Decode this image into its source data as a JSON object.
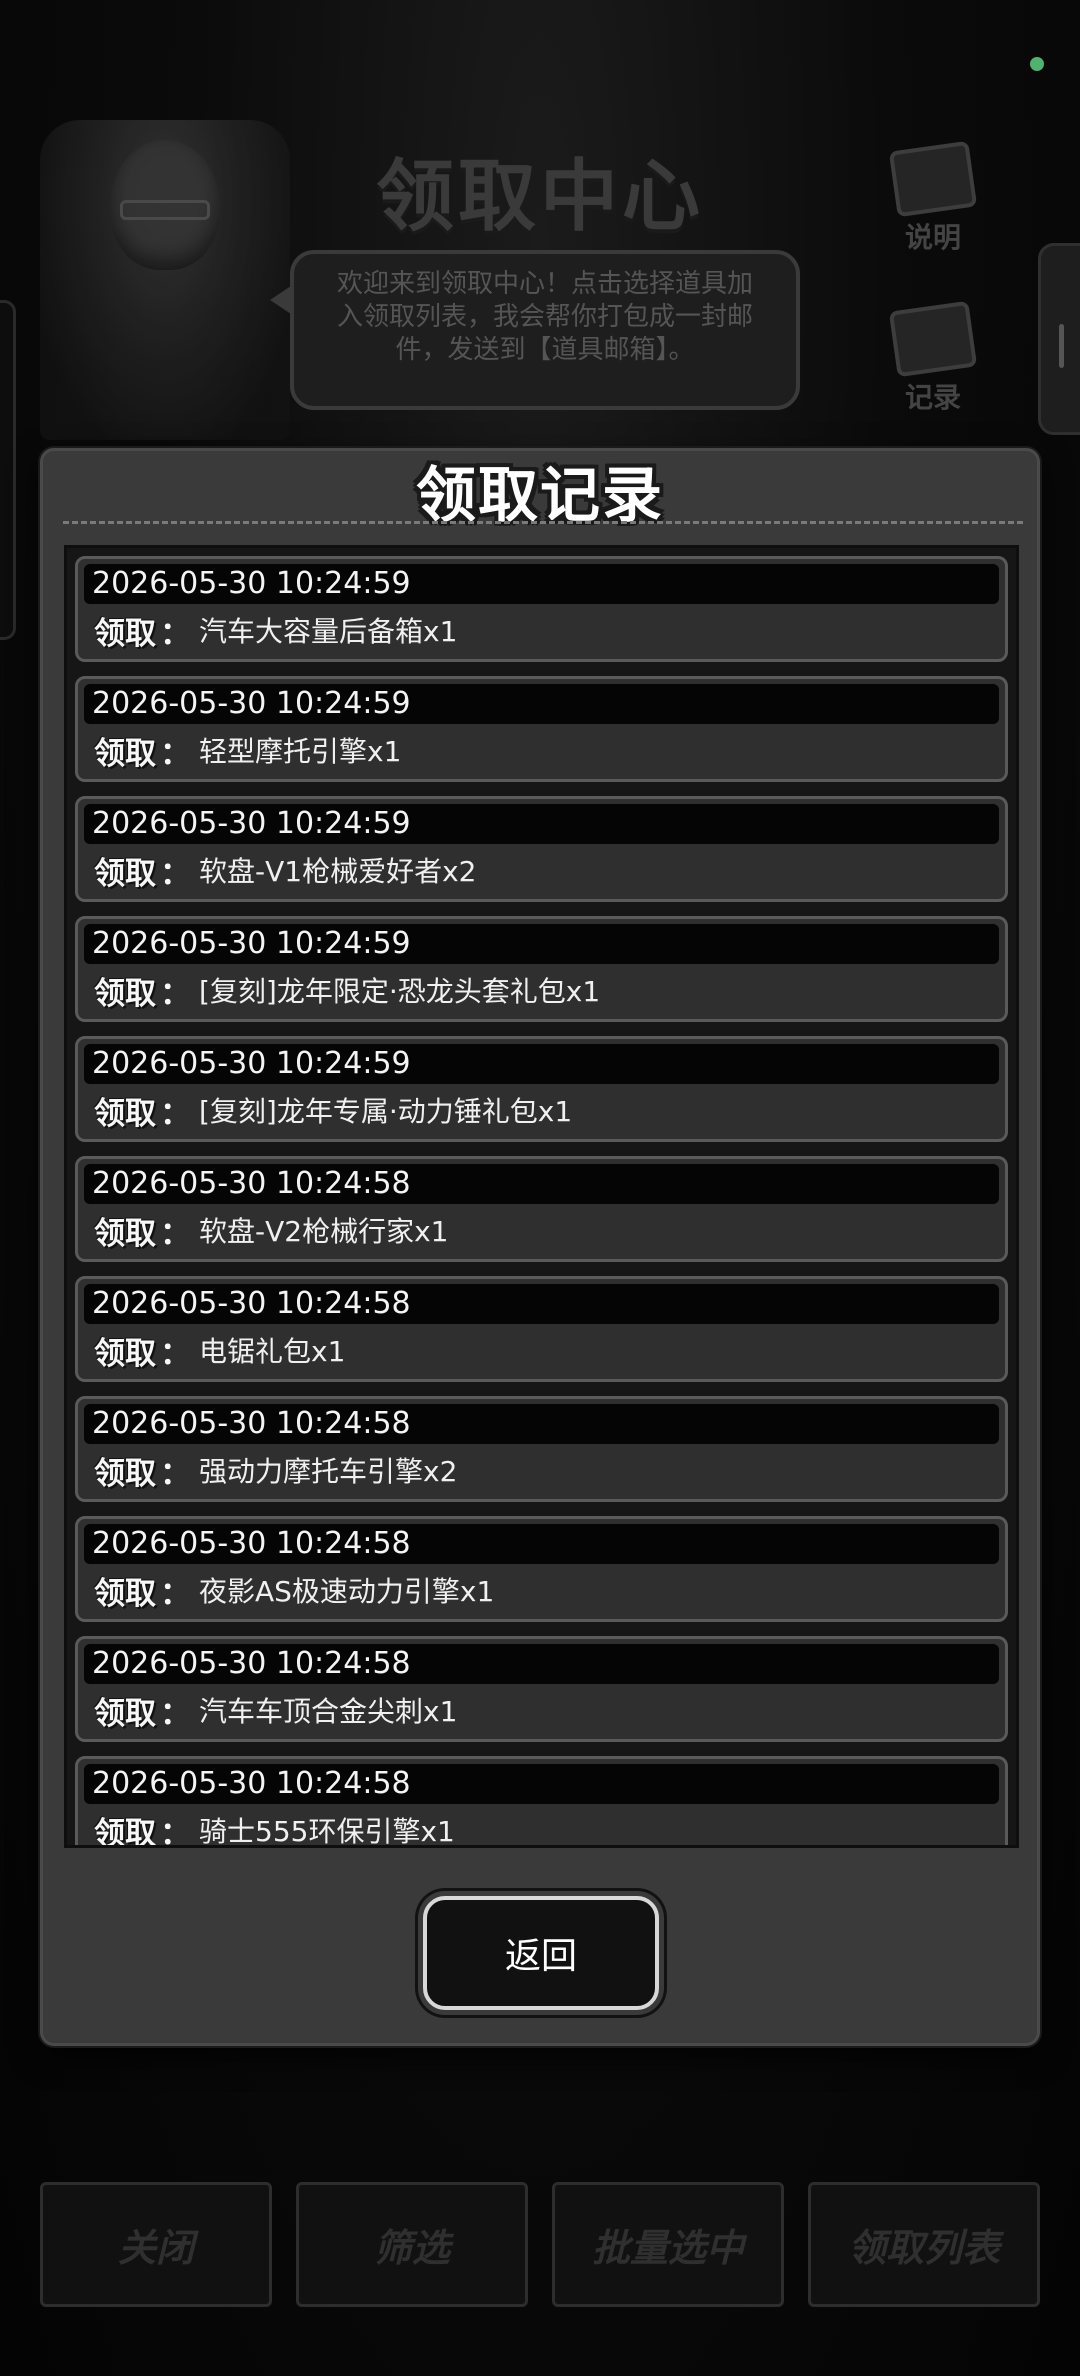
{
  "background": {
    "title": "领取中心",
    "welcome_text": "欢迎来到领取中心！点击选择道具加入领取列表，我会帮你打包成一封邮件，发送到【道具邮箱】。",
    "side_buttons": [
      {
        "label": "说明",
        "icon": "book-icon"
      },
      {
        "label": "记录",
        "icon": "clipboard-icon"
      }
    ],
    "bottom_buttons": [
      "关闭",
      "筛选",
      "批量选中",
      "领取列表"
    ]
  },
  "modal": {
    "title": "领取记录",
    "receive_label": "领取",
    "colon": "：",
    "back_label": "返回",
    "records": [
      {
        "time": "2026-05-30 10:24:59",
        "item": "汽车大容量后备箱x1"
      },
      {
        "time": "2026-05-30 10:24:59",
        "item": "轻型摩托引擎x1"
      },
      {
        "time": "2026-05-30 10:24:59",
        "item": "软盘-V1枪械爱好者x2"
      },
      {
        "time": "2026-05-30 10:24:59",
        "item": "[复刻]龙年限定·恐龙头套礼包x1"
      },
      {
        "time": "2026-05-30 10:24:59",
        "item": "[复刻]龙年专属·动力锤礼包x1"
      },
      {
        "time": "2026-05-30 10:24:58",
        "item": "软盘-V2枪械行家x1"
      },
      {
        "time": "2026-05-30 10:24:58",
        "item": "电锯礼包x1"
      },
      {
        "time": "2026-05-30 10:24:58",
        "item": "强动力摩托车引擎x2"
      },
      {
        "time": "2026-05-30 10:24:58",
        "item": "夜影AS极速动力引擎x1"
      },
      {
        "time": "2026-05-30 10:24:58",
        "item": "汽车车顶合金尖刺x1"
      },
      {
        "time": "2026-05-30 10:24:58",
        "item": "骑士555环保引擎x1"
      }
    ]
  },
  "colors": {
    "modal_bg": "#3a3a3a",
    "list_bg": "#161616",
    "status_dot": "#4fb36f"
  }
}
